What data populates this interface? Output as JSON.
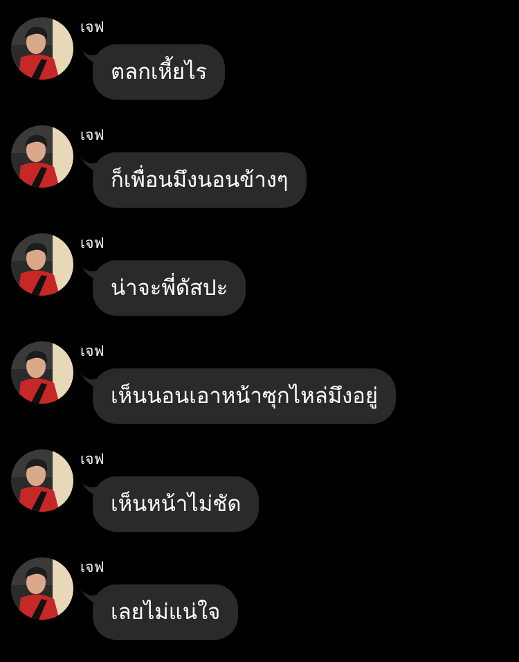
{
  "messages": [
    {
      "sender": "เจฟ",
      "text": "ตลกเหี้ยไร"
    },
    {
      "sender": "เจฟ",
      "text": "ก็เพื่อนมึงนอนข้างๆ"
    },
    {
      "sender": "เจฟ",
      "text": "น่าจะพี่ดัสปะ"
    },
    {
      "sender": "เจฟ",
      "text": "เห็นนอนเอาหน้าซุกไหล่มึงอยู่"
    },
    {
      "sender": "เจฟ",
      "text": "เห็นหน้าไม่ชัด"
    },
    {
      "sender": "เจฟ",
      "text": "เลยไม่แน่ใจ"
    }
  ],
  "colors": {
    "background": "#000000",
    "bubble": "#2a2a2a",
    "text": "#ffffff"
  },
  "icons": {
    "avatar": "profile-photo-icon"
  }
}
